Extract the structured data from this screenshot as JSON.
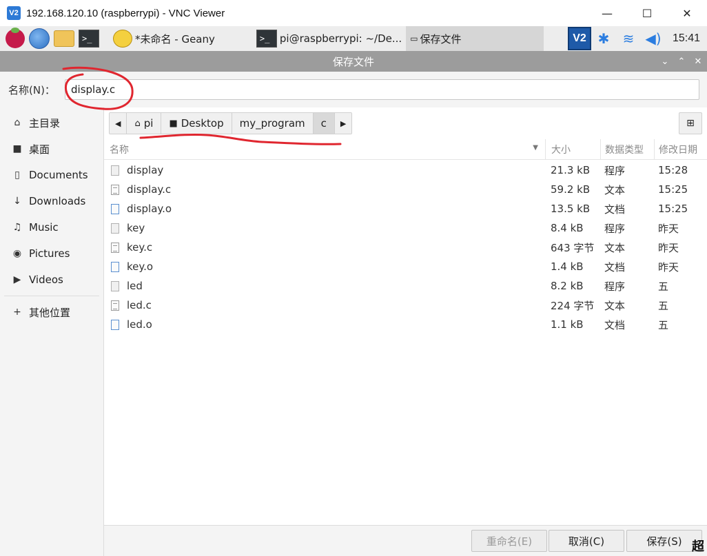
{
  "vnc_window": {
    "logo_text": "V2",
    "title": "192.168.120.10 (raspberrypi) - VNC Viewer",
    "minimize": "—",
    "maximize": "☐",
    "close": "✕"
  },
  "taskbar": {
    "terminal_prompt": ">_",
    "tasks": [
      {
        "label": "*未命名 - Geany"
      },
      {
        "label": "pi@raspberrypi: ~/De..."
      },
      {
        "label": "保存文件"
      }
    ],
    "tray": {
      "vnc_text": "V2",
      "time": "15:41"
    }
  },
  "dialog": {
    "title": "保存文件",
    "name_label": "名称(N)：",
    "name_value": "display.c"
  },
  "sidebar": {
    "items": [
      {
        "label": "主目录",
        "icon": "home-icon",
        "glyph": "⌂"
      },
      {
        "label": "桌面",
        "icon": "folder-icon",
        "glyph": "■"
      },
      {
        "label": "Documents",
        "icon": "document-icon",
        "glyph": "▯"
      },
      {
        "label": "Downloads",
        "icon": "download-icon",
        "glyph": "↓"
      },
      {
        "label": "Music",
        "icon": "music-icon",
        "glyph": "♫"
      },
      {
        "label": "Pictures",
        "icon": "camera-icon",
        "glyph": "◉"
      },
      {
        "label": "Videos",
        "icon": "video-icon",
        "glyph": "▶"
      }
    ],
    "other_locations": {
      "label": "其他位置",
      "glyph": "+"
    }
  },
  "pathbar": {
    "crumbs": [
      {
        "label": "pi",
        "icon": "home-icon",
        "glyph": "⌂"
      },
      {
        "label": "Desktop",
        "icon": "folder-icon",
        "glyph": "■"
      },
      {
        "label": "my_program"
      },
      {
        "label": "c",
        "current": true
      }
    ],
    "left_arrow": "◀",
    "right_arrow": "▶",
    "new_folder_glyph": "⊞"
  },
  "table": {
    "headers": {
      "name": "名称",
      "size": "大小",
      "type": "数据类型",
      "date": "修改日期"
    },
    "rows": [
      {
        "name": "display",
        "size": "21.3 kB",
        "type": "程序",
        "date": "15:28",
        "kind": "exe"
      },
      {
        "name": "display.c",
        "size": "59.2 kB",
        "type": "文本",
        "date": "15:25",
        "kind": "doc"
      },
      {
        "name": "display.o",
        "size": "13.5 kB",
        "type": "文档",
        "date": "15:25",
        "kind": "obj"
      },
      {
        "name": "key",
        "size": "8.4 kB",
        "type": "程序",
        "date": "昨天",
        "kind": "exe"
      },
      {
        "name": "key.c",
        "size": "643 字节",
        "type": "文本",
        "date": "昨天",
        "kind": "doc"
      },
      {
        "name": "key.o",
        "size": "1.4 kB",
        "type": "文档",
        "date": "昨天",
        "kind": "obj"
      },
      {
        "name": "led",
        "size": "8.2 kB",
        "type": "程序",
        "date": "五",
        "kind": "exe"
      },
      {
        "name": "led.c",
        "size": "224 字节",
        "type": "文本",
        "date": "五",
        "kind": "doc"
      },
      {
        "name": "led.o",
        "size": "1.1 kB",
        "type": "文档",
        "date": "五",
        "kind": "obj"
      }
    ]
  },
  "buttons": {
    "rename": "重命名(E)",
    "cancel": "取消(C)",
    "save": "保存(S)"
  },
  "corner_glyph": "超",
  "colors": {
    "dialog_header": "#9c9c9c",
    "annotation": "#e0262f",
    "accent_blue": "#2b7de0"
  }
}
